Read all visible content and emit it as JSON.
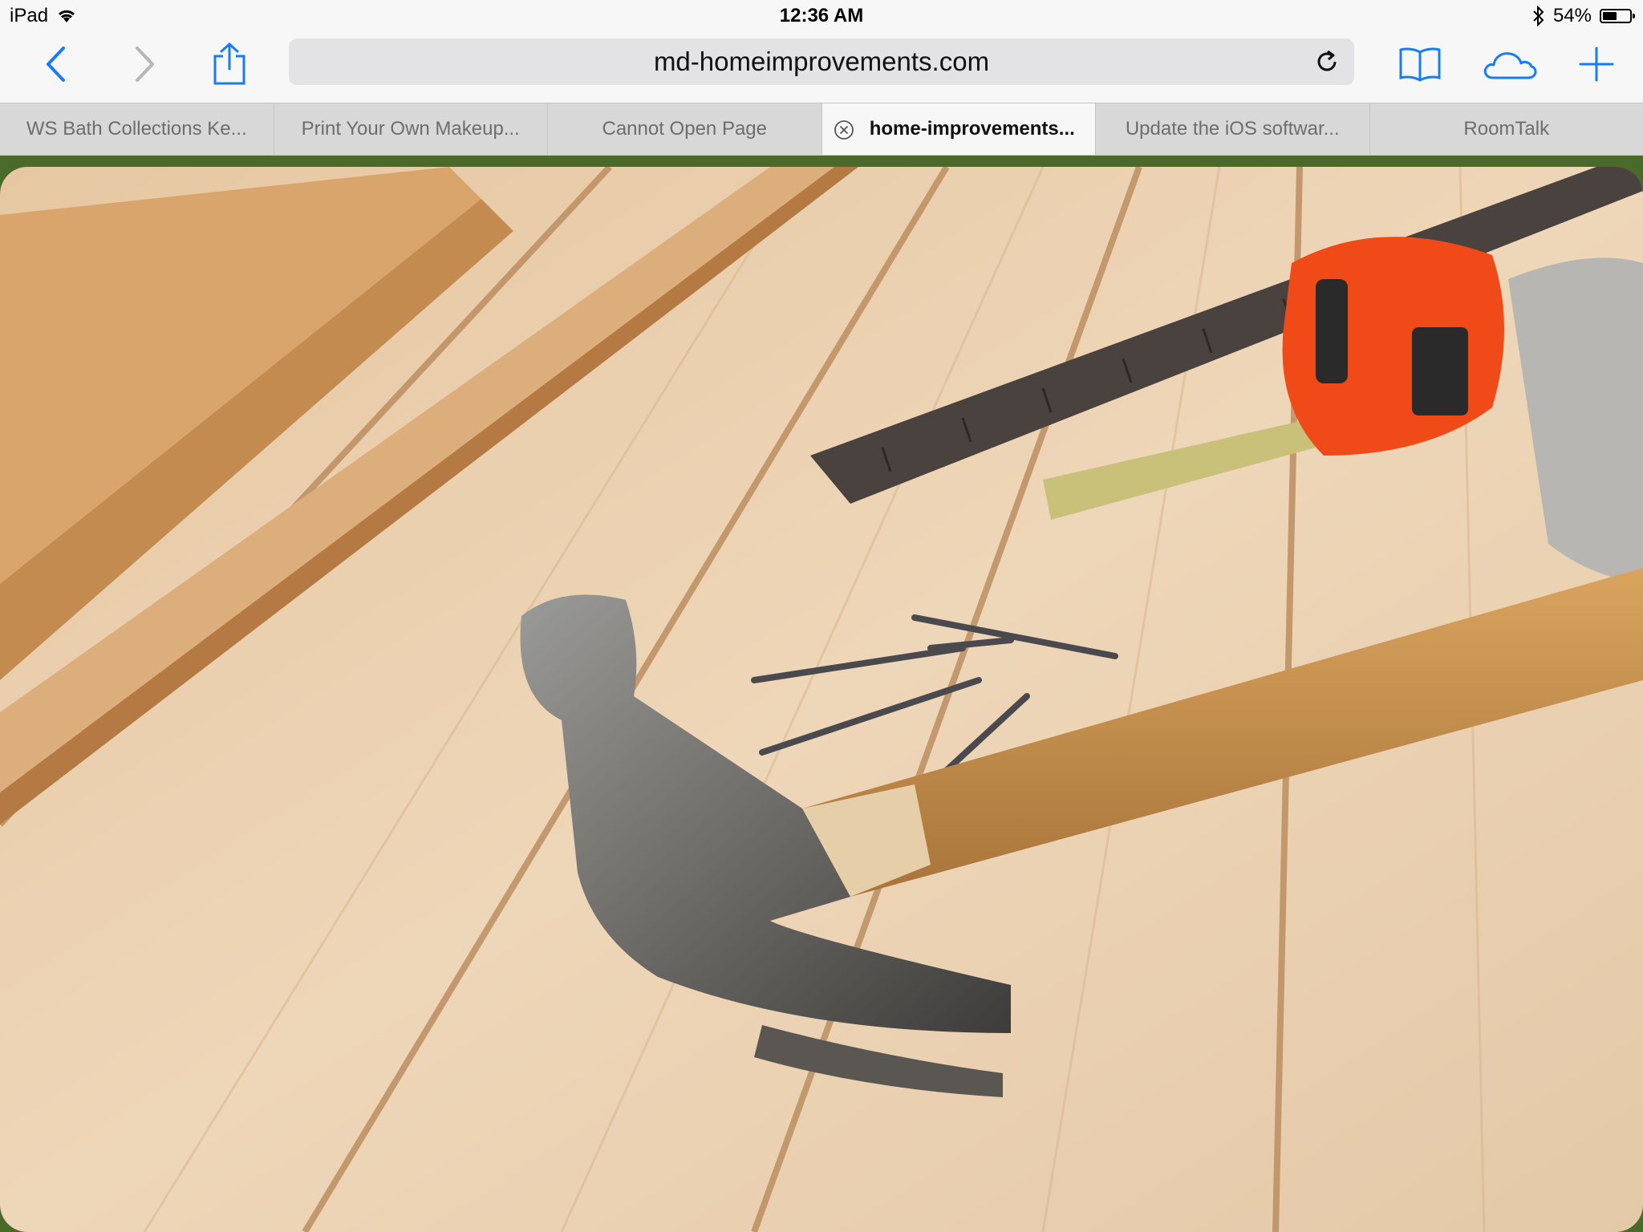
{
  "status_bar": {
    "device": "iPad",
    "time": "12:36 AM",
    "battery_text": "54%",
    "battery_level": 0.54,
    "icons": [
      "wifi-icon",
      "bluetooth-icon",
      "battery-icon"
    ]
  },
  "toolbar": {
    "url": "md-homeimprovements.com",
    "icons": [
      "back-icon",
      "forward-icon",
      "share-icon",
      "reload-icon",
      "bookmarks-icon",
      "icloud-tabs-icon",
      "new-tab-icon"
    ],
    "accent_color": "#1a7cf5"
  },
  "tabs": [
    {
      "label": "WS Bath Collections Ke...",
      "active": false
    },
    {
      "label": "Print Your Own Makeup...",
      "active": false
    },
    {
      "label": "Cannot Open Page",
      "active": false
    },
    {
      "label": "home-improvements...",
      "active": true
    },
    {
      "label": "Update the iOS softwar...",
      "active": false
    },
    {
      "label": "RoomTalk",
      "active": false
    }
  ],
  "content": {
    "image_subject": "carpentry-tools-on-wood-planks",
    "colors": {
      "wood": "#e9cfae",
      "tape_measure": "#f04a18",
      "hammer_handle": "#c08a4a"
    }
  }
}
